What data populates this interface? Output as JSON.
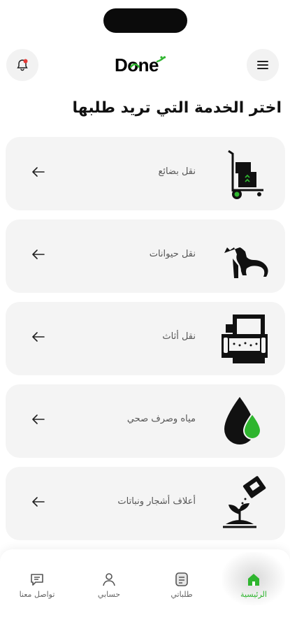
{
  "app": {
    "logo_text": "Done",
    "brand_green": "#2fb52f",
    "notification_dot": "#e53935"
  },
  "header": {
    "menu_icon": "hamburger-menu-icon",
    "notifications_icon": "bell-icon"
  },
  "page": {
    "title": "اختر الخدمة التي تريد طلبها"
  },
  "services": [
    {
      "label": "نقل بضائع",
      "icon": "hand-truck-boxes-icon"
    },
    {
      "label": "نقل حيوانات",
      "icon": "dog-icon"
    },
    {
      "label": "نقل أثاث",
      "icon": "sofa-furniture-icon"
    },
    {
      "label": "مياه وصرف صحي",
      "icon": "water-drop-icon"
    },
    {
      "label": "أعلاف أشجار ونباتات",
      "icon": "plant-fertilizer-icon"
    }
  ],
  "tabbar": {
    "home": "الرئيسية",
    "orders": "طلباتي",
    "account": "حسابي",
    "contact": "تواصل معنا"
  }
}
